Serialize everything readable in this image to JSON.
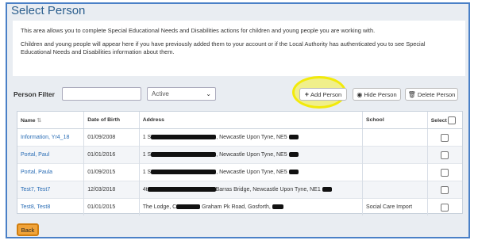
{
  "page": {
    "title": "Select Person"
  },
  "info": {
    "paragraph1": "This area allows you to complete Special Educational Needs and Disabilities actions for children and young people you are working with.",
    "paragraph2": "Children and young people will appear here if you have previously added them to your account or if the Local Authority has authenticated you to see Special Educational Needs and Disabilities information about them."
  },
  "filter": {
    "label": "Person Filter",
    "value": "",
    "status_selected": "Active"
  },
  "buttons": {
    "add": "Add Person",
    "hide": "Hide Person",
    "delete": "Delete Person",
    "back": "Back"
  },
  "table": {
    "headers": {
      "name": "Name",
      "dob": "Date of Birth",
      "address": "Address",
      "school": "School",
      "select": "Select"
    },
    "rows": [
      {
        "name": "Information, Yr4_18",
        "dob": "01/09/2008",
        "addr_pre": "1 S",
        "addr_post": ", Newcastle Upon Tyne, NE5",
        "school": ""
      },
      {
        "name": "Portal, Paul",
        "dob": "01/01/2016",
        "addr_pre": "1 S",
        "addr_post": ", Newcastle Upon Tyne, NE5",
        "school": ""
      },
      {
        "name": "Portal, Paula",
        "dob": "01/09/2015",
        "addr_pre": "1 S",
        "addr_post": ", Newcastle Upon Tyne, NE5",
        "school": ""
      },
      {
        "name": "Test7, Test7",
        "dob": "12/03/2018",
        "addr_pre": "4t",
        "addr_post": "Barras Bridge, Newcastle Upon Tyne, NE1",
        "school": ""
      },
      {
        "name": "Test8, Test8",
        "dob": "01/01/2015",
        "addr_pre": "The Lodge, C",
        "addr_post": "Graham Pk Road, Gosforth,",
        "school": "Social Care Import"
      }
    ]
  },
  "colors": {
    "highlight": "#f2ea0a",
    "back_button": "#f0a33a",
    "link": "#2a6db5",
    "title": "#2c5f8e"
  }
}
